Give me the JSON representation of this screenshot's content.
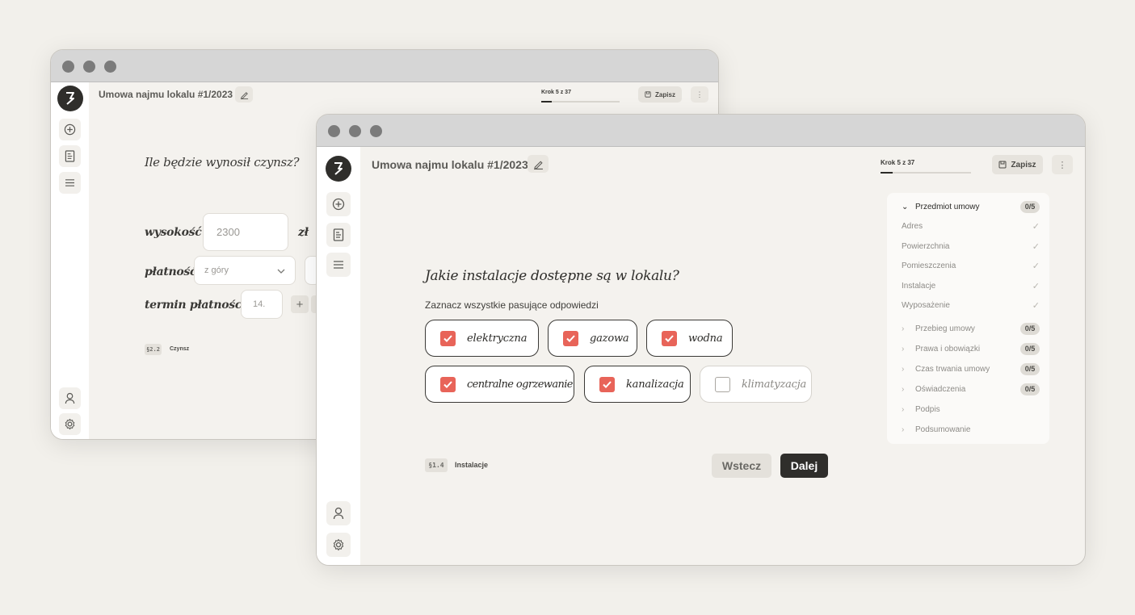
{
  "back_window": {
    "header": {
      "title": "Umowa najmu lokalu #1/2023",
      "step_label": "Krok 5 z 37",
      "progress_fraction": 0.135,
      "save_label": "Zapisz"
    },
    "question": "Ile będzie wynosił czynsz?",
    "fields": {
      "amount_label": "wysokość",
      "amount_value": "2300",
      "currency": "zł",
      "payment_label": "płatność",
      "payment_value": "z góry",
      "deadline_label": "termin płatności do",
      "deadline_value": "14.",
      "plus": "+"
    },
    "section_tag": "§2.2",
    "section_name": "Czynsz"
  },
  "front_window": {
    "header": {
      "title": "Umowa najmu lokalu #1/2023",
      "step_label": "Krok 5 z 37",
      "progress_fraction": 0.135,
      "save_label": "Zapisz"
    },
    "question": "Jakie instalacje dostępne są w lokalu?",
    "subtitle": "Zaznacz wszystkie pasujące odpowiedzi",
    "options": [
      {
        "label": "elektryczna",
        "checked": true
      },
      {
        "label": "gazowa",
        "checked": true
      },
      {
        "label": "wodna",
        "checked": true
      },
      {
        "label": "centralne ogrzewanie",
        "checked": true
      },
      {
        "label": "kanalizacja",
        "checked": true
      },
      {
        "label": "klimatyzacja",
        "checked": false
      }
    ],
    "section_tag": "§1.4",
    "section_name": "Instalacje",
    "back_label": "Wstecz",
    "next_label": "Dalej",
    "toc": {
      "head": {
        "label": "Przedmiot umowy",
        "badge": "0/5"
      },
      "sub_items": [
        "Adres",
        "Powierzchnia",
        "Pomieszczenia",
        "Instalacje",
        "Wyposażenie"
      ],
      "sections": [
        {
          "label": "Przebieg umowy",
          "badge": "0/5"
        },
        {
          "label": "Prawa i obowiązki",
          "badge": "0/5"
        },
        {
          "label": "Czas trwania umowy",
          "badge": "0/5"
        },
        {
          "label": "Oświadczenia",
          "badge": "0/5"
        },
        {
          "label": "Podpis",
          "badge": ""
        },
        {
          "label": "Podsumowanie",
          "badge": ""
        }
      ]
    }
  },
  "colors": {
    "accent_checkbox": "#e86459",
    "primary_button": "#2f2e2b",
    "background": "#f2f0eb"
  },
  "icons": [
    "logo-icon",
    "add-icon",
    "document-icon",
    "list-icon",
    "user-icon",
    "settings-icon",
    "pencil-icon",
    "save-icon",
    "more-icon",
    "chevron-down-icon",
    "chevron-right-icon",
    "check-icon"
  ]
}
